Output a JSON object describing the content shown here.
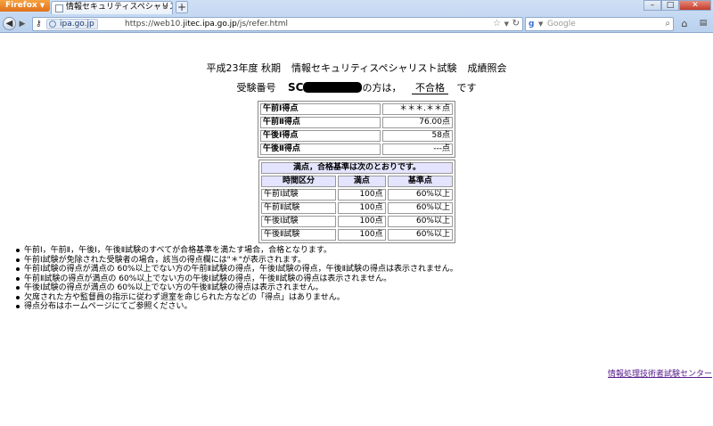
{
  "browser": {
    "app_button": "Firefox",
    "tab_title": "情報セキュリティスペシャリスト試験...",
    "new_tab": "+",
    "url_site_badge": "ipa.go.jp",
    "url_prefix": "https://web10.",
    "url_domain": "jitec.ipa.go.jp",
    "url_path": "/js/refer.html",
    "search_engine_icon": "google-icon",
    "search_placeholder": "Google"
  },
  "page": {
    "title_part1": "平成23年度 秋期",
    "title_part2": "情報セキュリティスペシャリスト試験",
    "title_part3": "成績照会",
    "exam_number_label": "受験番号",
    "exam_number_prefix": "SC",
    "after_number": "の方は，",
    "result": "不合格",
    "suffix": "です"
  },
  "scores": [
    {
      "name": "午前Ⅰ得点",
      "value": "＊＊＊.＊＊点"
    },
    {
      "name": "午前Ⅱ得点",
      "value": "76.00点"
    },
    {
      "name": "午後Ⅰ得点",
      "value": "58点"
    },
    {
      "name": "午後Ⅱ得点",
      "value": "---点"
    }
  ],
  "criteria": {
    "caption": "満点，合格基準は次のとおりです。",
    "headers": [
      "時間区分",
      "満点",
      "基準点"
    ],
    "rows": [
      [
        "午前Ⅰ試験",
        "100点",
        "60%以上"
      ],
      [
        "午前Ⅱ試験",
        "100点",
        "60%以上"
      ],
      [
        "午後Ⅰ試験",
        "100点",
        "60%以上"
      ],
      [
        "午後Ⅱ試験",
        "100点",
        "60%以上"
      ]
    ]
  },
  "notes": [
    "午前Ⅰ，午前Ⅱ，午後Ⅰ，午後Ⅱ試験のすべてが合格基準を満たす場合，合格となります。",
    "午前Ⅰ試験が免除された受験者の場合，該当の得点欄には\"＊\"が表示されます。",
    "午前Ⅰ試験の得点が満点の 60%以上でない方の午前Ⅱ試験の得点，午後Ⅰ試験の得点，午後Ⅱ試験の得点は表示されません。",
    "午前Ⅱ試験の得点が満点の 60%以上でない方の午後Ⅰ試験の得点，午後Ⅱ試験の得点は表示されません。",
    "午後Ⅰ試験の得点が満点の 60%以上でない方の午後Ⅱ試験の得点は表示されません。",
    "欠席された方や監督員の指示に従わず退室を命じられた方などの「得点」はありません。",
    "得点分布はホームページにてご参照ください。"
  ],
  "footer_link": "情報処理技術者試験センター"
}
